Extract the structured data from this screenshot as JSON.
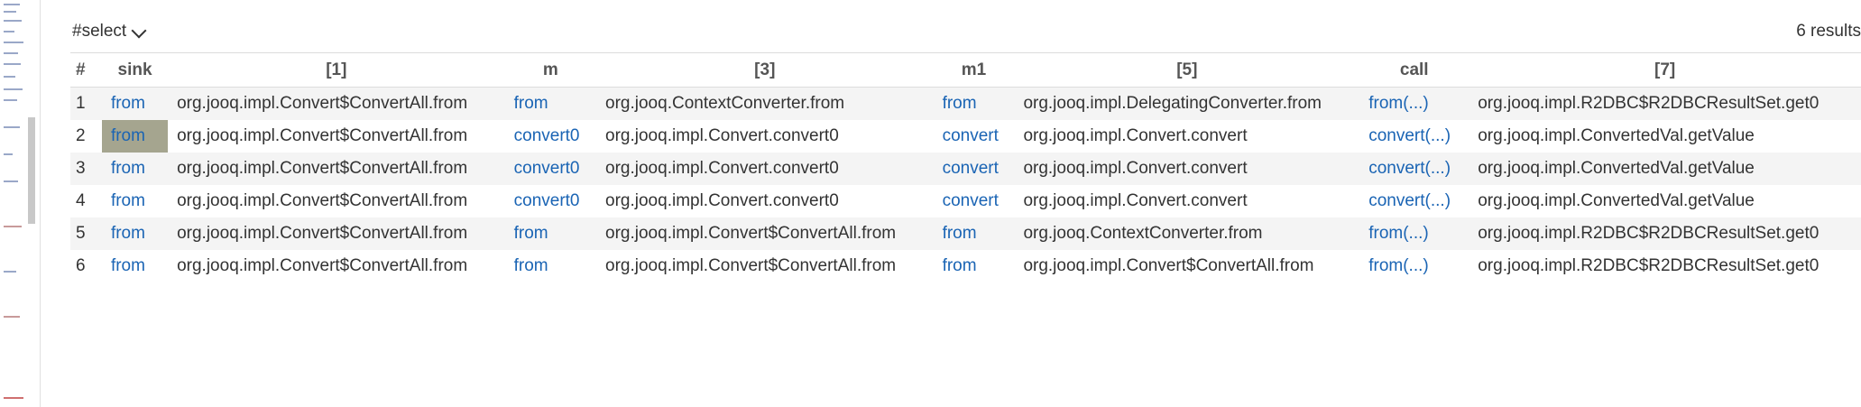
{
  "toolbar": {
    "select_label": "#select",
    "results_count": "6 results"
  },
  "table": {
    "headers": [
      "#",
      "sink",
      "[1]",
      "m",
      "[3]",
      "m1",
      "[5]",
      "call",
      "[7]"
    ],
    "rows": [
      [
        "1",
        "from",
        "org.jooq.impl.Convert$ConvertAll.from",
        "from",
        "org.jooq.ContextConverter.from",
        "from",
        "org.jooq.impl.DelegatingConverter.from",
        "from(...)",
        "org.jooq.impl.R2DBC$R2DBCResultSet.get0"
      ],
      [
        "2",
        "from",
        "org.jooq.impl.Convert$ConvertAll.from",
        "convert0",
        "org.jooq.impl.Convert.convert0",
        "convert",
        "org.jooq.impl.Convert.convert",
        "convert(...)",
        "org.jooq.impl.ConvertedVal.getValue"
      ],
      [
        "3",
        "from",
        "org.jooq.impl.Convert$ConvertAll.from",
        "convert0",
        "org.jooq.impl.Convert.convert0",
        "convert",
        "org.jooq.impl.Convert.convert",
        "convert(...)",
        "org.jooq.impl.ConvertedVal.getValue"
      ],
      [
        "4",
        "from",
        "org.jooq.impl.Convert$ConvertAll.from",
        "convert0",
        "org.jooq.impl.Convert.convert0",
        "convert",
        "org.jooq.impl.Convert.convert",
        "convert(...)",
        "org.jooq.impl.ConvertedVal.getValue"
      ],
      [
        "5",
        "from",
        "org.jooq.impl.Convert$ConvertAll.from",
        "from",
        "org.jooq.impl.Convert$ConvertAll.from",
        "from",
        "org.jooq.ContextConverter.from",
        "from(...)",
        "org.jooq.impl.R2DBC$R2DBCResultSet.get0"
      ],
      [
        "6",
        "from",
        "org.jooq.impl.Convert$ConvertAll.from",
        "from",
        "org.jooq.impl.Convert$ConvertAll.from",
        "from",
        "org.jooq.impl.Convert$ConvertAll.from",
        "from(...)",
        "org.jooq.impl.R2DBC$R2DBCResultSet.get0"
      ]
    ],
    "selected_cell": {
      "row": 2,
      "column": "sink"
    }
  },
  "colors": {
    "link": "#1a64b4",
    "selected_cell": "#a5a58f",
    "stripe": "#f4f4f4"
  }
}
